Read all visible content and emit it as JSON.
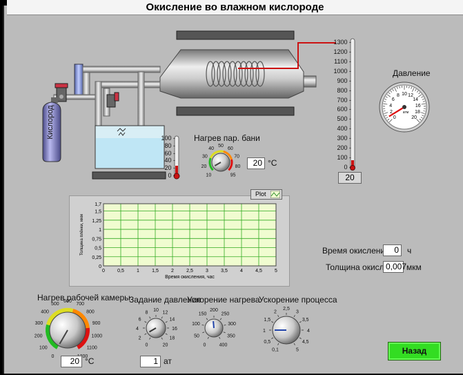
{
  "window": {
    "title": "Окисление во влажном кислороде"
  },
  "apparatus": {
    "cylinder_label": "Кислород",
    "bath_scale": [
      "100",
      "80",
      "60",
      "40",
      "20",
      "0"
    ],
    "chamber_scale": [
      "1300",
      "1200",
      "1100",
      "1000",
      "900",
      "800",
      "700",
      "600",
      "500",
      "400",
      "300",
      "200",
      "100",
      "0"
    ],
    "chamber_temperature": "20"
  },
  "bath_heater": {
    "label": "Нагрев пар. бани",
    "ticks": [
      "10",
      "20",
      "30",
      "40",
      "50",
      "60",
      "70",
      "80",
      "95"
    ],
    "value": "20",
    "unit": "°C"
  },
  "pressure_gauge": {
    "label": "Давление",
    "unit": "атм",
    "ticks": [
      "0",
      "2",
      "4",
      "6",
      "8",
      "10",
      "12",
      "14",
      "16",
      "18",
      "20"
    ]
  },
  "chart_data": {
    "type": "line",
    "title": "",
    "legend": "Plot",
    "xlabel": "Время окисления, час",
    "ylabel": "Толщина плёнки, мкм",
    "xlim": [
      0,
      5
    ],
    "ylim": [
      0,
      1.7
    ],
    "x_ticks": [
      "0",
      "0,5",
      "1",
      "1,5",
      "2",
      "2,5",
      "3",
      "3,5",
      "4",
      "4,5",
      "5"
    ],
    "y_ticks": [
      "0",
      "0,25",
      "0,5",
      "0,75",
      "1",
      "1,25",
      "1,5",
      "1,7"
    ],
    "series": [
      {
        "name": "Plot",
        "x": [],
        "y": []
      }
    ]
  },
  "readouts": {
    "time_label": "Время окисления:",
    "time_value": "0",
    "time_unit": "ч",
    "thickness_label": "Толщина окисла:",
    "thickness_value": "0,007",
    "thickness_unit": "мкм"
  },
  "controls": {
    "chamber_heating": {
      "label": "Нагрев рабочей камеры",
      "ticks": [
        "0",
        "100",
        "200",
        "300",
        "400",
        "500",
        "600",
        "700",
        "800",
        "900",
        "1000",
        "1100",
        "1200"
      ],
      "value": "20",
      "unit": "°C"
    },
    "pressure_setting": {
      "label": "Задание давления",
      "ticks": [
        "0",
        "2",
        "4",
        "6",
        "8",
        "10",
        "12",
        "14",
        "16",
        "18",
        "20"
      ],
      "value": "1",
      "unit": "ат"
    },
    "heating_rate": {
      "label": "Ускорение нагрева",
      "ticks": [
        "0",
        "50",
        "100",
        "150",
        "200",
        "250",
        "300",
        "350",
        "400"
      ]
    },
    "process_rate": {
      "label": "Ускорение процесса",
      "ticks": [
        "0,1",
        "0,5",
        "1",
        "1,5",
        "2",
        "2,5",
        "3",
        "3,5",
        "4",
        "4,5",
        "5"
      ]
    }
  },
  "buttons": {
    "back": "Назад"
  },
  "colors": {
    "panel": "#bbbbbb",
    "plot_bg": "#f0fcd0",
    "plot_grid": "#33aa22",
    "back_button": "#33dd22",
    "thermometer_red": "#cc1111",
    "water": "#bfe6f5"
  }
}
